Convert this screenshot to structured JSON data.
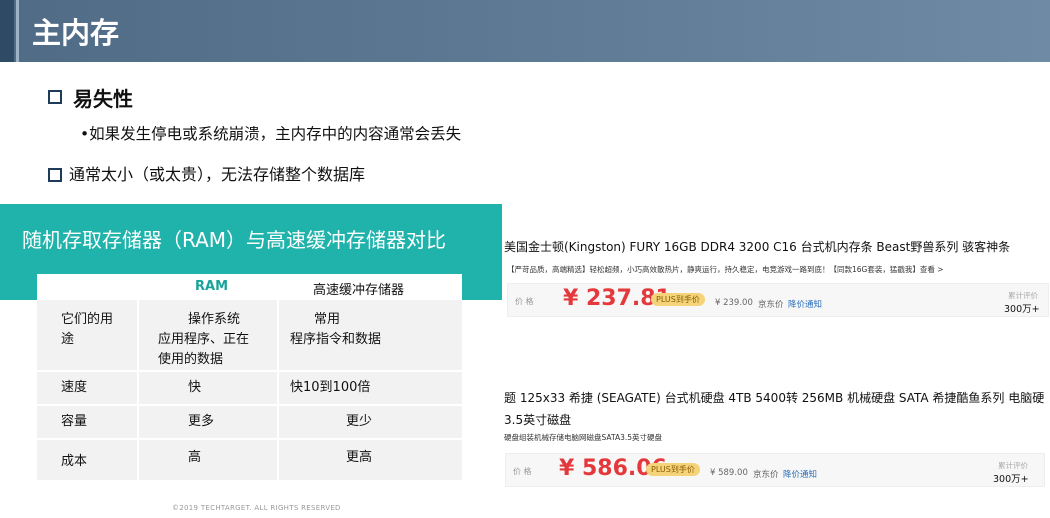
{
  "slide": {
    "title": "主内存",
    "bullet1": "易失性",
    "sub_bullet1": "•如果发生停电或系统崩溃，主内存中的内容通常会丢失",
    "bullet2": "通常太小（或太贵），无法存储整个数据库"
  },
  "comparison": {
    "title": "随机存取存储器（RAM）与高速缓冲存储器对比",
    "headers": {
      "ram": "RAM",
      "cache": "高速缓冲存储器"
    },
    "rows": [
      {
        "label_line1": "它们的用",
        "label_line2": "途",
        "ram_line1": "操作系统",
        "ram_line2": "应用程序、正在",
        "ram_line3": "使用的数据",
        "cache_line1": "常用",
        "cache_line2": "程序指令和数据"
      },
      {
        "label": "速度",
        "ram": "快",
        "cache": "快10到100倍"
      },
      {
        "label": "容量",
        "ram": "更多",
        "cache": "更少"
      },
      {
        "label": "成本",
        "ram": "高",
        "cache": "更高"
      }
    ],
    "copyright": "©2019 TECHTARGET. ALL RIGHTS RESERVED"
  },
  "products": [
    {
      "title": "美国金士顿(Kingston) FURY 16GB DDR4 3200 C16 台式机内存条 Beast野兽系列 骇客神条",
      "desc": "【严苛品质，高端精选】轻松超频，小巧高效散热片，静爽运行，持久稳定，电竞游戏一路到底！【同款16G套装，猛戳我】查看 >",
      "price_label": "价  格",
      "price": "¥ 237.81",
      "plus_badge": "PLUS到手价",
      "jd_price": "¥ 239.00",
      "jd_label": "京东价",
      "notify": "降价通知",
      "eval_label": "累计评价",
      "eval_count": "300万+"
    },
    {
      "title_line1": "题 125x33 希捷 (SEAGATE) 台式机硬盘 4TB 5400转 256MB 机械硬盘 SATA 希捷酷鱼系列 电脑硬",
      "title_line2": "3.5英寸磁盘",
      "desc": "硬盘组装机械存储电脑网磁盘SATA3.5英寸硬盘",
      "price_label": "价  格",
      "price": "¥ 586.06",
      "plus_badge": "PLUS到手价",
      "jd_price": "¥ 589.00",
      "jd_label": "京东价",
      "notify": "降价通知",
      "eval_label": "累计评价",
      "eval_count": "300万+"
    }
  ],
  "colors": {
    "title_bar": "#5c7893",
    "teal_header": "#20b3ab",
    "price_red": "#e4393c"
  }
}
